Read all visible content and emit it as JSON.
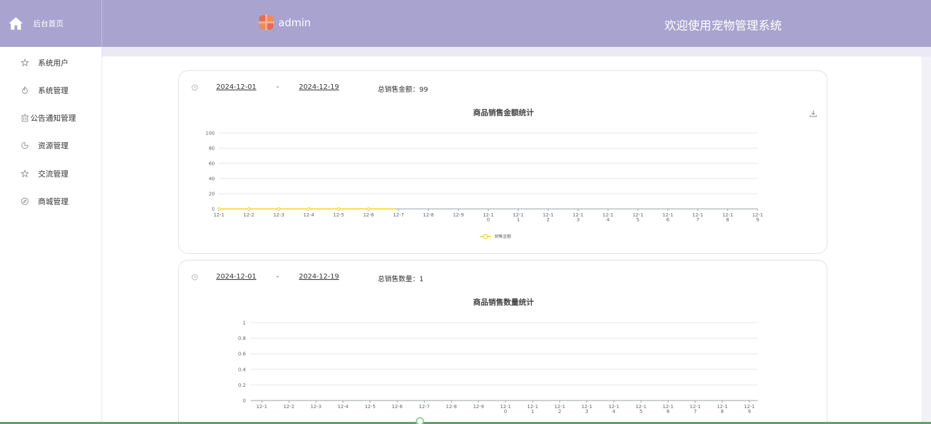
{
  "header": {
    "brand_label": "后台首页",
    "username": "admin",
    "welcome": "欢迎使用宠物管理系统",
    "accent": "#a9a3cf"
  },
  "sidebar": {
    "items": [
      {
        "label": "系统用户",
        "icon": "star-icon"
      },
      {
        "label": "系统管理",
        "icon": "flame-icon"
      },
      {
        "label": "公告通知管理",
        "icon": "bin-icon"
      },
      {
        "label": "资源管理",
        "icon": "pie-icon"
      },
      {
        "label": "交流管理",
        "icon": "star-icon"
      },
      {
        "label": "商城管理",
        "icon": "compass-icon"
      }
    ]
  },
  "sales_amount_panel": {
    "start_date": "2024-12-01",
    "separator": "-",
    "end_date": "2024-12-19",
    "total_label": "总销售金额：",
    "total_value": "99",
    "title": "商品销售金额统计"
  },
  "sales_quantity_panel": {
    "start_date": "2024-12-01",
    "separator": "-",
    "end_date": "2024-12-19",
    "total_label": "总销售数量：",
    "total_value": "1",
    "title": "商品销售数量统计"
  },
  "chart_data": [
    {
      "type": "line",
      "title": "商品销售金额统计",
      "categories": [
        "12-1",
        "12-2",
        "12-3",
        "12-4",
        "12-5",
        "12-6",
        "12-7",
        "12-8",
        "12-9",
        "12-10",
        "12-11",
        "12-12",
        "12-13",
        "12-14",
        "12-15",
        "12-16",
        "12-17",
        "12-18",
        "12-19"
      ],
      "series": [
        {
          "name": "销售金额",
          "values": [
            0,
            0,
            0,
            0,
            0,
            0,
            null,
            null,
            null,
            null,
            null,
            null,
            null,
            null,
            null,
            null,
            null,
            null,
            null
          ],
          "color": "#f2d31b"
        }
      ],
      "yticks": [
        "0",
        "20",
        "40",
        "60",
        "80",
        "100"
      ],
      "ylim": [
        0,
        100
      ],
      "grid": true,
      "legend": "bottom"
    },
    {
      "type": "line",
      "title": "商品销售数量统计",
      "categories": [
        "12-1",
        "12-2",
        "12-3",
        "12-4",
        "12-5",
        "12-6",
        "12-7",
        "12-8",
        "12-9",
        "12-10",
        "12-11",
        "12-12",
        "12-13",
        "12-14",
        "12-15",
        "12-16",
        "12-17",
        "12-18",
        "12-19"
      ],
      "series": [],
      "yticks": [
        "0",
        "0.2",
        "0.4",
        "0.6",
        "0.8",
        "1"
      ],
      "ylim": [
        0,
        1
      ],
      "grid": true,
      "legend": "bottom"
    }
  ]
}
